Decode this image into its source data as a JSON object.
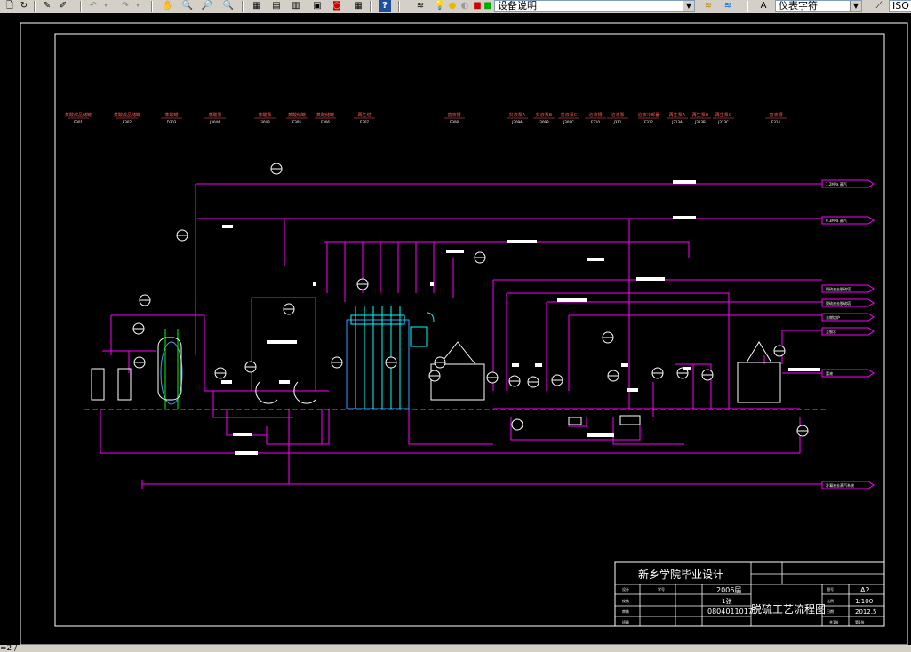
{
  "app": {
    "toolbar": {
      "layer_value": "设备说明",
      "text_style_value": "仪表字符",
      "trailing_label": "ISO"
    },
    "status": {
      "text": "=2 /"
    }
  },
  "drawing": {
    "equipment_tags": [
      {
        "name": "蒸酸成品储罐",
        "code": "F301"
      },
      {
        "name": "蒸酸成品储罐",
        "code": "F302"
      },
      {
        "name": "蒸酸罐",
        "code": "D303"
      },
      {
        "name": "蒸酸泵",
        "code": "J304A"
      },
      {
        "name": "蒸酸泵",
        "code": "J304B"
      },
      {
        "name": "蒸酸储罐",
        "code": "F305"
      },
      {
        "name": "蒸酸储罐",
        "code": "F306"
      },
      {
        "name": "再生塔",
        "code": "F307"
      },
      {
        "name": "富液槽",
        "code": "F308"
      },
      {
        "name": "贫液泵A",
        "code": "J309A"
      },
      {
        "name": "贫液泵B",
        "code": "J309B"
      },
      {
        "name": "贫液泵C",
        "code": "J309C"
      },
      {
        "name": "溶液槽",
        "code": "F310"
      },
      {
        "name": "溶液泵",
        "code": "J311"
      },
      {
        "name": "溶液冷却器",
        "code": "F312"
      },
      {
        "name": "再生泵A",
        "code": "J313A"
      },
      {
        "name": "再生泵B",
        "code": "J313B"
      },
      {
        "name": "再生泵C",
        "code": "J313C"
      },
      {
        "name": "富液槽",
        "code": "F314"
      }
    ],
    "line_tags": [
      "1.2MPa 蒸汽",
      "0.3MPa 蒸汽",
      "脱硫液去脱硫塔",
      "脱硫液去脱硫塔",
      "去燃烧炉",
      "至脱水",
      "富液",
      "冷凝液去蒸汽系统"
    ],
    "title_block": {
      "school": "新乡学院毕业设计",
      "drawing_title": "脱硫工艺流程图",
      "year": "2006届",
      "sheet": "1张",
      "student_no": "0804011017",
      "size": "A2",
      "scale": "1:100",
      "date": "2012.5",
      "small_labels": [
        "设计",
        "校核",
        "审核",
        "班级",
        "学号",
        "比例",
        "图号",
        "日期",
        "共1张",
        "第1张"
      ]
    }
  }
}
